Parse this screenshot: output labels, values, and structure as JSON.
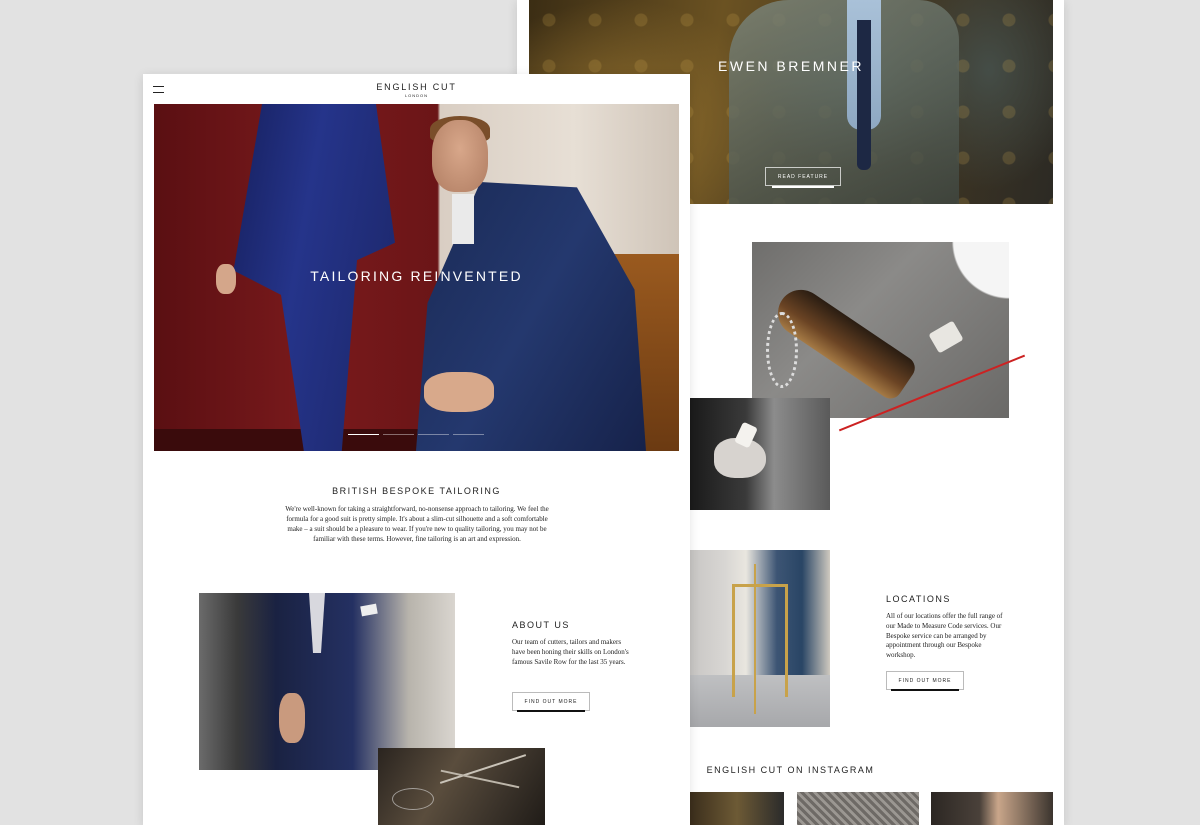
{
  "right_page": {
    "feature": {
      "title": "EWEN BREMNER",
      "button_label": "READ FEATURE"
    },
    "locations": {
      "title": "LOCATIONS",
      "text": "All of our locations offer the full range of our Made to Measure Code services. Our Bespoke service can be arranged by appointment through our Bespoke workshop.",
      "button_label": "FIND OUT MORE"
    },
    "instagram": {
      "title": "ENGLISH CUT ON INSTAGRAM"
    }
  },
  "left_page": {
    "header": {
      "brand": "ENGLISH CUT",
      "city": "LONDON"
    },
    "hero": {
      "title": "TAILORING REINVENTED",
      "slides": 4,
      "active_slide": 1
    },
    "intro": {
      "title": "BRITISH BESPOKE TAILORING",
      "text": "We're well-known for taking a straightforward, no-nonsense approach to tailoring. We feel the formula for a good suit is pretty simple. It's about a slim-cut silhouette and a soft comfortable make – a suit should be a pleasure to wear. If you're new to quality tailoring, you may not be familiar with these terms. However, fine tailoring is an art and expression."
    },
    "about": {
      "title": "ABOUT US",
      "text": "Our team of cutters, tailors and makers have been honing their skills on London's famous Savile Row for the last 35 years.",
      "button_label": "FIND OUT MORE"
    }
  },
  "colors": {
    "background": "#e2e2e2",
    "page": "#ffffff",
    "text": "#222222"
  },
  "icons": {
    "menu": "hamburger-menu-icon"
  }
}
